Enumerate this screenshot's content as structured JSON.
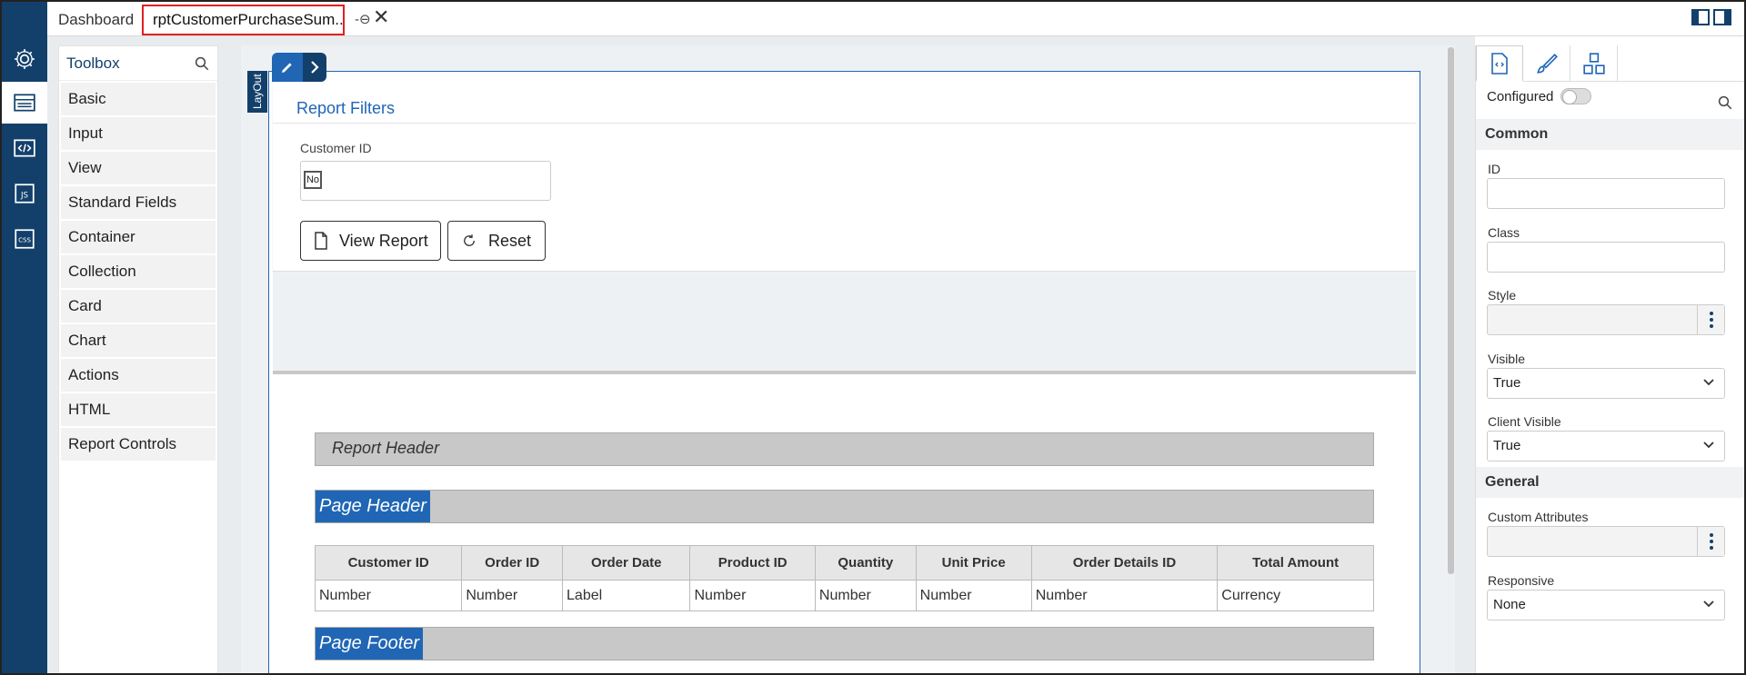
{
  "tabs": {
    "dashboard": "Dashboard",
    "active": "rptCustomerPurchaseSum...",
    "pin_glyph": "-⊖",
    "close_glyph": "✕"
  },
  "rail": {
    "icons": [
      "gear-icon",
      "layout-icon",
      "code-icon",
      "js-icon",
      "css-icon"
    ],
    "js_label": "JS",
    "css_label": "CSS"
  },
  "toolbox": {
    "title": "Toolbox",
    "items": [
      "Basic",
      "Input",
      "View",
      "Standard Fields",
      "Container",
      "Collection",
      "Card",
      "Chart",
      "Actions",
      "HTML",
      "Report Controls"
    ]
  },
  "canvas": {
    "layout_tag": "LayOut",
    "filters": {
      "title": "Report Filters",
      "customer_id_label": "Customer ID",
      "no_checkbox": "No",
      "view_report": "View Report",
      "reset": "Reset"
    },
    "report": {
      "report_header": "Report Header",
      "page_header": "Page Header",
      "page_footer": "Page Footer",
      "columns": [
        "Customer ID",
        "Order ID",
        "Order Date",
        "Product ID",
        "Quantity",
        "Unit Price",
        "Order Details ID",
        "Total Amount"
      ],
      "row": [
        "Number",
        "Number",
        "Label",
        "Number",
        "Number",
        "Number",
        "Number",
        "Currency"
      ]
    }
  },
  "properties": {
    "configured_label": "Configured",
    "configured": false,
    "common_title": "Common",
    "id_label": "ID",
    "id_value": "",
    "class_label": "Class",
    "class_value": "",
    "style_label": "Style",
    "visible_label": "Visible",
    "visible_value": "True",
    "client_visible_label": "Client Visible",
    "client_visible_value": "True",
    "general_title": "General",
    "custom_attributes_label": "Custom Attributes",
    "responsive_label": "Responsive",
    "responsive_value": "None"
  },
  "colors": {
    "rail": "#13406b",
    "accent": "#2066b5",
    "active_tab_border": "#e02020",
    "band": "#c8c8c8"
  }
}
